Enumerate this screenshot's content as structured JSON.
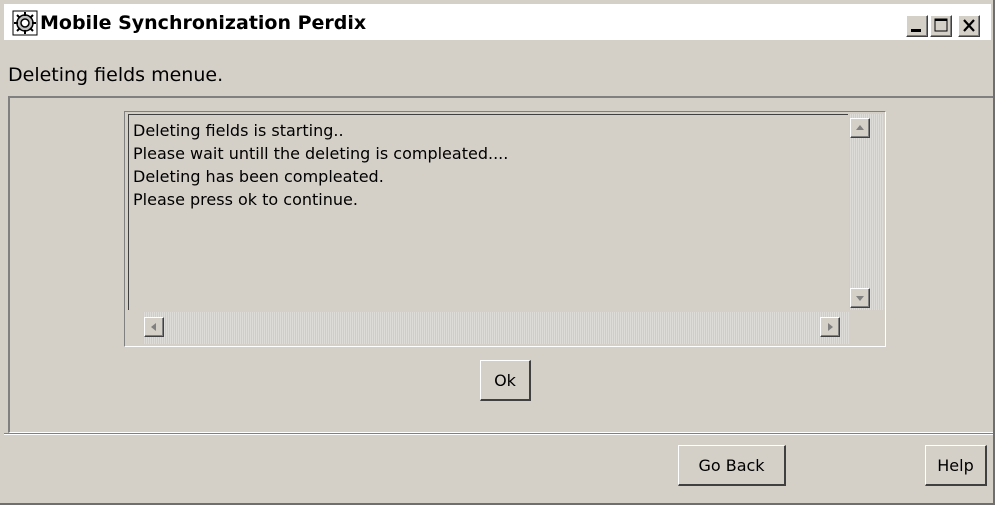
{
  "window": {
    "title": "Mobile Synchronization Perdix",
    "icon": "cog-app-icon",
    "controls": {
      "minimize": "minimize-icon",
      "maximize": "maximize-icon",
      "close": "close-icon"
    }
  },
  "header": {
    "label": "Deleting fields menue."
  },
  "log": {
    "lines": [
      "Deleting fields is starting..",
      "Please wait untill the deleting is compleated....",
      "Deleting has been compleated.",
      "Please press ok to continue."
    ]
  },
  "buttons": {
    "ok": "Ok",
    "go_back": "Go Back",
    "help": "Help"
  }
}
